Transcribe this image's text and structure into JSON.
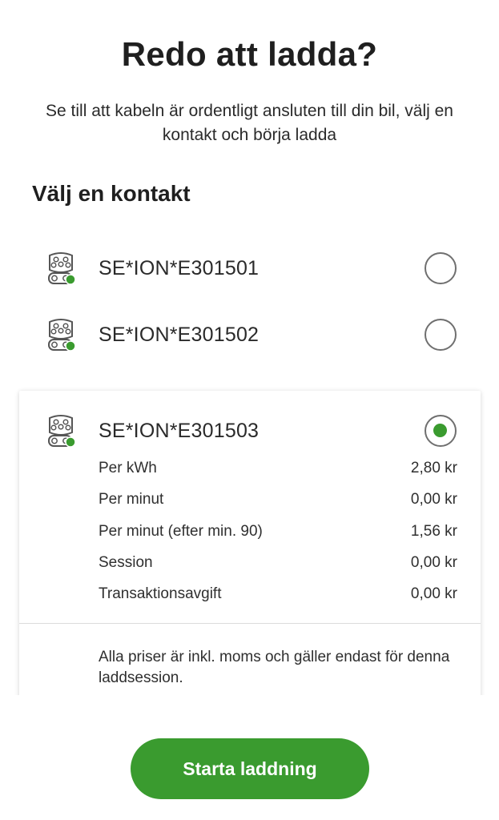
{
  "header": {
    "title": "Redo att ladda?",
    "subtitle": "Se till att kabeln är ordentligt ansluten till din bil, välj en kontakt och börja ladda"
  },
  "section_title": "Välj en kontakt",
  "connectors": [
    {
      "id": "SE*ION*E301501",
      "selected": false,
      "icon": "ccs-connector-icon",
      "status_color": "#3a9b2f"
    },
    {
      "id": "SE*ION*E301502",
      "selected": false,
      "icon": "ccs-connector-icon",
      "status_color": "#3a9b2f"
    },
    {
      "id": "SE*ION*E301503",
      "selected": true,
      "icon": "ccs-connector-icon",
      "status_color": "#3a9b2f"
    }
  ],
  "prices": [
    {
      "label": "Per kWh",
      "value": "2,80 kr"
    },
    {
      "label": "Per minut",
      "value": "0,00 kr"
    },
    {
      "label": "Per minut (efter min. 90)",
      "value": "1,56 kr"
    },
    {
      "label": "Session",
      "value": "0,00 kr"
    },
    {
      "label": "Transaktionsavgift",
      "value": "0,00 kr"
    }
  ],
  "price_note": "Alla priser är inkl. moms och gäller endast för denna laddsession.",
  "start_button": "Starta laddning",
  "colors": {
    "accent": "#3a9b2f"
  }
}
